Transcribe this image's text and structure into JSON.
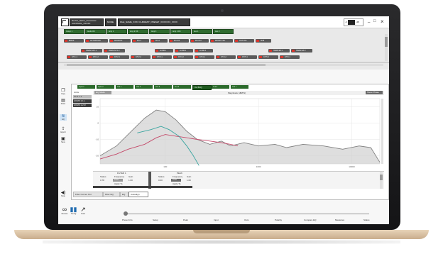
{
  "window": {
    "title_lines": [
      "Device_Name_Xxxxxxxxx",
      "CONTROL_XXXXX"
    ],
    "mode_label": "MODE",
    "status_text": "FILE_NAME_XXXX  CURRENT_PRESET_XXXXXXX_XXXX",
    "level_value": "-0",
    "level_unit": "dB",
    "min_label": "_",
    "max_label": "□",
    "close_label": "×"
  },
  "top_tabs": [
    "Group 1",
    "Audio OK",
    "Amp 1",
    "Amp 2 OK",
    "Amp 3",
    "Amp 4 OK",
    "Aux 1",
    "Aux 2"
  ],
  "channel_row1": [
    "BDIAF",
    "ACTIVATION",
    "FRONTAL",
    "FF+1",
    "FF+2",
    "FF+3/4",
    "FF+Out",
    "FRONT FILL",
    "OUT FILL",
    "SUB"
  ],
  "channel_row2": [
    "HARM SP 1.1",
    "HARM SP 1.2",
    "LF/SB 1",
    "LF/SB 2",
    "LF/SB 3",
    "HARM EX 1",
    "HARM EX 2"
  ],
  "channel_row3": [
    "CH 1.1",
    "CH 1.2",
    "CH 2.1",
    "CH 2.2",
    "CH 3.1",
    "CH 3.2",
    "CH 4.1",
    "CH 4.2",
    "CH 5.1",
    "CH 5.2",
    "CH 6.1"
  ],
  "filter_tabs": [
    "Input 1",
    "Input 2",
    "Out 1",
    "Out 2",
    "Out 3",
    "Out 4",
    "Out 5 EQ",
    "Out 6",
    "Out 7"
  ],
  "left_list": {
    "header": "Links",
    "items": [
      "OUT 1.1",
      "ACMS 1.1 L",
      "ACMS 1.2 R"
    ]
  },
  "chart_header": {
    "button_left": "EQ Mode",
    "title": "Magnitude (dB/FS)",
    "button_right": "Show Phase"
  },
  "sidebar_icons": [
    {
      "icon": "copy-icon",
      "label": "Copy"
    },
    {
      "icon": "paste-icon",
      "label": "Paste"
    },
    {
      "icon": "eq-icon",
      "label": "EQ"
    },
    {
      "icon": "export-icon",
      "label": "Export"
    },
    {
      "icon": "save-icon",
      "label": "Save"
    }
  ],
  "bands": {
    "left_header": "FILTER 1",
    "right_header": "PEAK",
    "labels": [
      "Status",
      "Frequency",
      "Gain",
      "Q"
    ],
    "left_values": [
      "0.78",
      "0.20",
      "1.00"
    ],
    "right_values": [
      "0.00",
      "0.00",
      "1.00"
    ],
    "bottom_left": "Apply To",
    "bottom_right": "Apply To"
  },
  "bottom_tabs": [
    "Filter Curves Out",
    "Filter EQ",
    "EQ",
    "Autoalign"
  ],
  "left_bottom_icon": "speaker-icon",
  "left_bottom_label": "Mute",
  "footer_tools": [
    {
      "icon": "network-icon",
      "label": "Remote"
    },
    {
      "icon": "bars-icon",
      "label": "Tuning"
    },
    {
      "icon": "wrench-icon",
      "label": "Tools"
    }
  ],
  "timeline": {
    "labels": [
      "Preset Info",
      "Setup",
      "Peak",
      "Input",
      "Outs",
      "Polarity",
      "Compare EQ",
      "Measures",
      "Status"
    ],
    "position": 0.02
  },
  "chart_data": {
    "type": "line",
    "x_ticks": [
      "100",
      "1000",
      "10000"
    ],
    "y_ticks": [
      "10",
      "0",
      "-10",
      "-20"
    ],
    "xlim": [
      20,
      20000
    ],
    "ylim": [
      -25,
      15
    ],
    "x_scale": "log",
    "grid": true,
    "series": [
      {
        "color": "#808080",
        "fill": "#d0d0d0",
        "x": [
          20,
          30,
          45,
          60,
          80,
          100,
          130,
          170,
          220,
          300,
          400,
          500,
          700,
          1000,
          1500,
          2000,
          3000,
          5000,
          8000,
          12000,
          16000,
          20000
        ],
        "values": [
          -20,
          -14,
          -4,
          3,
          8,
          7,
          2,
          -5,
          -10,
          -13,
          -11,
          -14,
          -12,
          -14,
          -13,
          -15,
          -13,
          -14,
          -16,
          -14,
          -15,
          -24
        ]
      },
      {
        "color": "#c44a6a",
        "x": [
          20,
          30,
          40,
          60,
          80,
          100,
          130,
          170,
          220,
          300,
          400,
          500,
          600
        ],
        "values": [
          -22,
          -19,
          -16,
          -13,
          -9,
          -7,
          -8,
          -9,
          -10,
          -11,
          -12,
          -13,
          -14
        ]
      },
      {
        "color": "#3aa5a0",
        "x": [
          50,
          70,
          90,
          110,
          140,
          170,
          200,
          230
        ],
        "values": [
          -6,
          -4,
          -2,
          -4,
          -8,
          -14,
          -20,
          -26
        ]
      }
    ]
  },
  "colors": {
    "accent_green": "#2f6b2f",
    "chip_red": "#d9342b",
    "bezel": "#1a1a1c",
    "aluminum": "#d8bf9f"
  }
}
